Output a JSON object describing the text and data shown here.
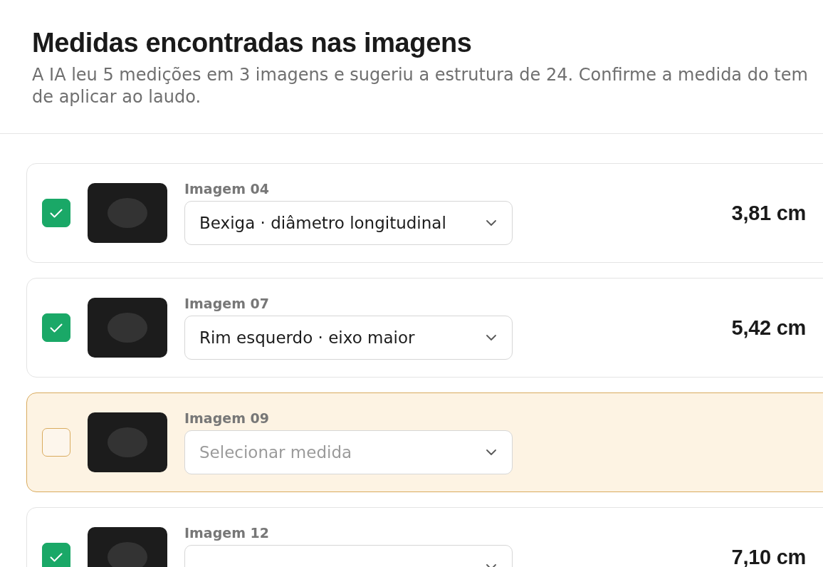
{
  "dialog": {
    "title": "Medidas encontradas nas imagens",
    "description_lines": [
      "A IA leu 5 medições em 3 imagens e sugeriu a estrutura de 24. Confirme a medida do tem",
      "de aplicar ao laudo."
    ]
  },
  "measurements": [
    {
      "image": "Imagem 04",
      "checked": true,
      "needs_review": false,
      "selection": "Bexiga · diâmetro longitudinal",
      "value": "3,81 cm"
    },
    {
      "image": "Imagem 07",
      "checked": true,
      "needs_review": false,
      "selection": "Rim esquerdo · eixo maior",
      "value": "5,42 cm"
    },
    {
      "image": "Imagem 09",
      "checked": false,
      "needs_review": true,
      "placeholder": "Selecionar medida"
    },
    {
      "image": "Imagem 12",
      "checked": true,
      "needs_review": false,
      "value": "7,10 cm"
    }
  ]
}
